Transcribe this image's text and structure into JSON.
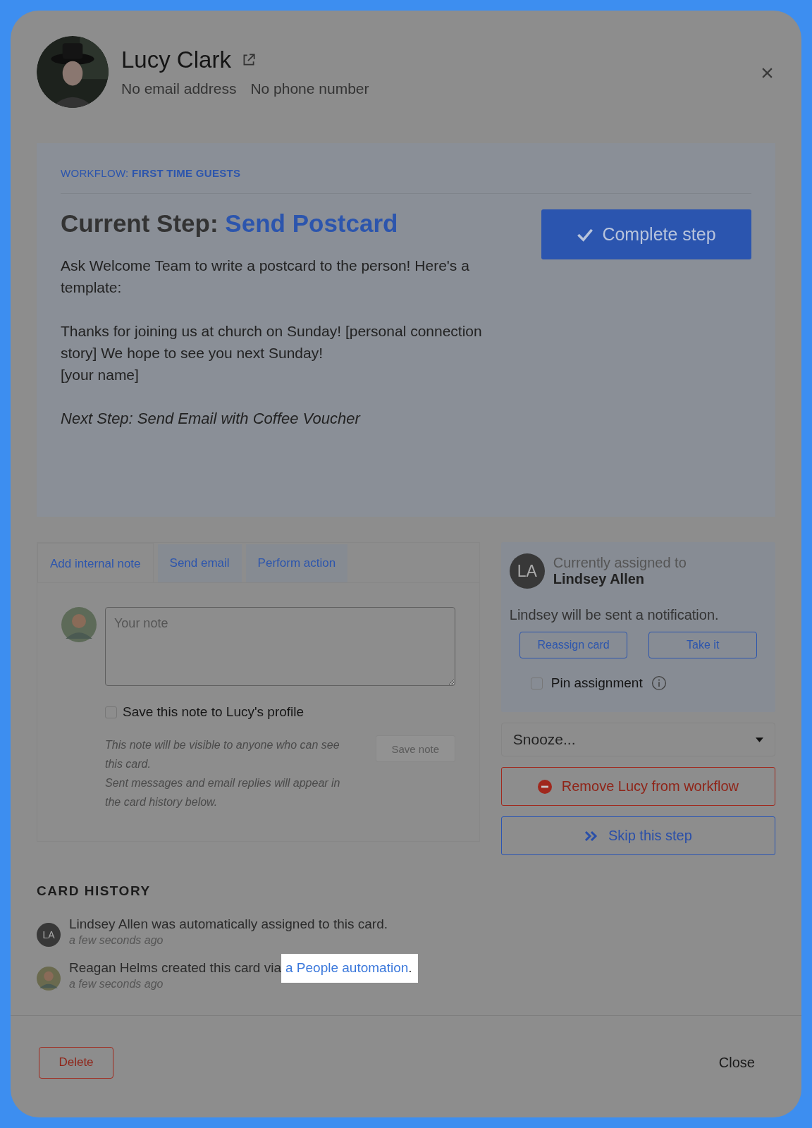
{
  "contact": {
    "name": "Lucy Clark",
    "email": "No email address",
    "phone": "No phone number"
  },
  "workflow": {
    "label": "WORKFLOW:",
    "name": "FIRST TIME GUESTS",
    "step_label": "Current Step:",
    "step_name": "Send Postcard",
    "complete_button": "Complete step",
    "description": [
      "Ask Welcome Team to write a postcard to the person! Here's a template:",
      "Thanks for joining us at church on Sunday! [personal connection story] We hope to see you next Sunday!\n[your name]"
    ],
    "next_step": "Next Step: Send Email with Coffee Voucher"
  },
  "tabs": [
    {
      "label": "Add internal note",
      "selected": true
    },
    {
      "label": "Send email",
      "selected": false
    },
    {
      "label": "Perform action",
      "selected": false
    }
  ],
  "note": {
    "placeholder": "Your note",
    "save_to_profile": {
      "label": "Save this note to Lucy's profile",
      "checked": false
    },
    "help": [
      "This note will be visible to anyone who can see this card.",
      "Sent messages and email replies will appear in the card history below."
    ],
    "save_button": "Save note",
    "save_disabled": true
  },
  "assignment": {
    "initials": "LA",
    "label": "Currently assigned to",
    "name": "Lindsey Allen",
    "notice": "Lindsey will be sent a notification.",
    "buttons": [
      "Reassign card",
      "Take it"
    ],
    "pin": {
      "label": "Pin assignment",
      "checked": false
    }
  },
  "snooze": {
    "value": "Snooze..."
  },
  "remove_button": "Remove Lucy from workflow",
  "skip_button": "Skip this step",
  "history": {
    "title": "CARD HISTORY",
    "entries": [
      {
        "kind": "initials",
        "initials": "LA",
        "text": "Lindsey Allen was automatically assigned to this card.",
        "time": "a few seconds ago"
      },
      {
        "text": "Reagan Helms created this card via",
        "link": "a People automation",
        "suffix": ".",
        "time": "a few seconds ago"
      }
    ]
  },
  "footer": {
    "delete": "Delete",
    "close": "Close"
  }
}
